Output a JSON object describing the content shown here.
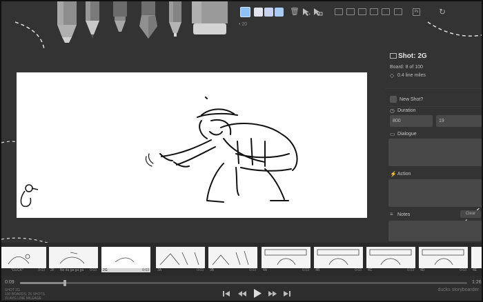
{
  "toolbar": {
    "tools": [
      {
        "name": "marker",
        "icon": "marker-icon"
      },
      {
        "name": "pencil",
        "icon": "pencil-icon"
      },
      {
        "name": "pen",
        "icon": "pen-icon"
      },
      {
        "name": "brush",
        "icon": "brush-icon"
      },
      {
        "name": "fineliner",
        "icon": "fineliner-icon"
      },
      {
        "name": "eraser",
        "icon": "eraser-icon"
      }
    ],
    "palette": [
      "#8ec2f4",
      "#e4e4ee",
      "#c6d2f0",
      "#a9ccf6"
    ],
    "brush_size": "• 20",
    "actions": [
      {
        "name": "trash",
        "icon": "trash-icon"
      },
      {
        "name": "move",
        "icon": "move-icon"
      },
      {
        "name": "scale",
        "icon": "scale-icon"
      }
    ],
    "view_icons": [
      "shot-layout-icon",
      "grid-icon",
      "layers-icon",
      "stack-icon",
      "sort-icon",
      "photoshop-icon",
      "refresh-icon"
    ]
  },
  "panel": {
    "title": "Shot: 2G",
    "board_info": "Board: 8 of 100",
    "line_miles": "0.4 line miles",
    "new_shot_label": "New Shot?",
    "duration_label": "Duration",
    "duration_ms": "800",
    "duration_frames": "19",
    "dialogue_label": "Dialogue",
    "action_label": "Action",
    "notes_label": "Notes",
    "clear_label": "Clear"
  },
  "timeline": {
    "boards": [
      {
        "num": "",
        "caption": "*DUCK*",
        "dur": "0:03"
      },
      {
        "num": "2F",
        "caption": "No da ga ga ga",
        "dur": "0:03"
      },
      {
        "num": "2G",
        "caption": "",
        "dur": "0:03",
        "selected": true
      },
      {
        "num": "3A",
        "caption": "",
        "dur": "0:03"
      },
      {
        "num": "3B",
        "caption": "",
        "dur": "0:03"
      },
      {
        "num": "4A",
        "caption": "",
        "dur": "0:03"
      },
      {
        "num": "4B",
        "caption": "",
        "dur": "0:03"
      },
      {
        "num": "4C",
        "caption": "",
        "dur": "0:03"
      },
      {
        "num": "4D",
        "caption": "",
        "dur": "0:03"
      },
      {
        "num": "4E",
        "caption": "",
        "dur": "0:03"
      }
    ]
  },
  "playback": {
    "current_time": "0:09",
    "total_time": "1:26",
    "progress": 0.1,
    "info_line1": "SHOT 2G",
    "info_line2": "100 BOARDS, 26 SHOTS",
    "info_line3": "31 AVG LINE MILEAGE",
    "credit": "ducks storyboarder"
  }
}
